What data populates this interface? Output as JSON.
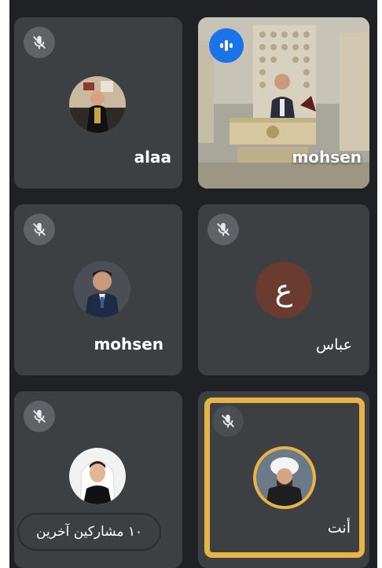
{
  "participants": {
    "alaa": {
      "name": "alaa",
      "avatar_icon": "person-photo-icon"
    },
    "mohsen_video": {
      "name": "mohsen",
      "status_icon": "speaking-icon"
    },
    "mohsen_2": {
      "name": "mohsen",
      "avatar_icon": "person-photo-icon"
    },
    "abbas": {
      "name": "عباس",
      "avatar_letter": "ع"
    },
    "participant_5": {
      "avatar_icon": "person-photo-icon"
    },
    "you": {
      "name": "أنت",
      "avatar_icon": "person-photo-icon"
    }
  },
  "others_pill": {
    "label": "١٠ مشاركين آخرين"
  },
  "colors": {
    "background": "#202124",
    "tile": "#3c4043",
    "self_highlight": "#e8b448",
    "speaking_badge": "#1a73e8",
    "letter_avatar": "#6a3b2e"
  }
}
